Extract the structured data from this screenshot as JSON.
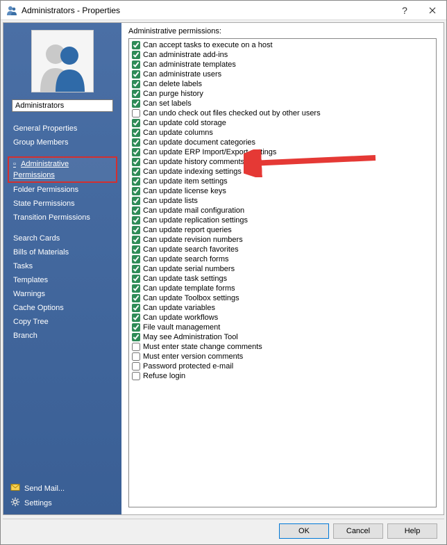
{
  "window": {
    "title": "Administrators - Properties"
  },
  "sidebar": {
    "group_name": "Administrators",
    "groups": [
      {
        "items": [
          {
            "label": "General Properties",
            "key": "general-properties"
          },
          {
            "label": "Group Members",
            "key": "group-members"
          }
        ]
      },
      {
        "items": [
          {
            "label": "Administrative Permissions",
            "key": "administrative-permissions",
            "selected": true
          },
          {
            "label": "Folder Permissions",
            "key": "folder-permissions"
          },
          {
            "label": "State Permissions",
            "key": "state-permissions"
          },
          {
            "label": "Transition Permissions",
            "key": "transition-permissions"
          }
        ]
      },
      {
        "items": [
          {
            "label": "Search Cards",
            "key": "search-cards"
          },
          {
            "label": "Bills of Materials",
            "key": "bills-of-materials"
          },
          {
            "label": "Tasks",
            "key": "tasks"
          },
          {
            "label": "Templates",
            "key": "templates"
          },
          {
            "label": "Warnings",
            "key": "warnings"
          },
          {
            "label": "Cache Options",
            "key": "cache-options"
          },
          {
            "label": "Copy Tree",
            "key": "copy-tree"
          },
          {
            "label": "Branch",
            "key": "branch"
          }
        ]
      }
    ],
    "bottom": {
      "send_mail": "Send Mail...",
      "settings": "Settings"
    }
  },
  "main": {
    "section_label": "Administrative permissions:",
    "permissions": [
      {
        "label": "Can accept tasks to execute on a host",
        "checked": true
      },
      {
        "label": "Can administrate add-ins",
        "checked": true
      },
      {
        "label": "Can administrate templates",
        "checked": true
      },
      {
        "label": "Can administrate users",
        "checked": true
      },
      {
        "label": "Can delete labels",
        "checked": true
      },
      {
        "label": "Can purge history",
        "checked": true
      },
      {
        "label": "Can set labels",
        "checked": true
      },
      {
        "label": "Can undo check out files checked out by other users",
        "checked": false
      },
      {
        "label": "Can update cold storage",
        "checked": true
      },
      {
        "label": "Can update columns",
        "checked": true
      },
      {
        "label": "Can update document categories",
        "checked": true
      },
      {
        "label": "Can update ERP Import/Export settings",
        "checked": true
      },
      {
        "label": "Can update history comments",
        "checked": true,
        "arrow": true
      },
      {
        "label": "Can update indexing settings",
        "checked": true
      },
      {
        "label": "Can update item settings",
        "checked": true
      },
      {
        "label": "Can update license keys",
        "checked": true
      },
      {
        "label": "Can update lists",
        "checked": true
      },
      {
        "label": "Can update mail configuration",
        "checked": true
      },
      {
        "label": "Can update replication settings",
        "checked": true
      },
      {
        "label": "Can update report queries",
        "checked": true
      },
      {
        "label": "Can update revision numbers",
        "checked": true
      },
      {
        "label": "Can update search favorites",
        "checked": true
      },
      {
        "label": "Can update search forms",
        "checked": true
      },
      {
        "label": "Can update serial numbers",
        "checked": true
      },
      {
        "label": "Can update task settings",
        "checked": true
      },
      {
        "label": "Can update template forms",
        "checked": true
      },
      {
        "label": "Can update Toolbox settings",
        "checked": true
      },
      {
        "label": "Can update variables",
        "checked": true
      },
      {
        "label": "Can update workflows",
        "checked": true
      },
      {
        "label": "File vault management",
        "checked": true
      },
      {
        "label": "May see Administration Tool",
        "checked": true
      },
      {
        "label": "Must enter state change comments",
        "checked": false
      },
      {
        "label": "Must enter version comments",
        "checked": false
      },
      {
        "label": "Password protected e-mail",
        "checked": false
      },
      {
        "label": "Refuse login",
        "checked": false
      }
    ]
  },
  "buttons": {
    "ok": "OK",
    "cancel": "Cancel",
    "help": "Help"
  }
}
